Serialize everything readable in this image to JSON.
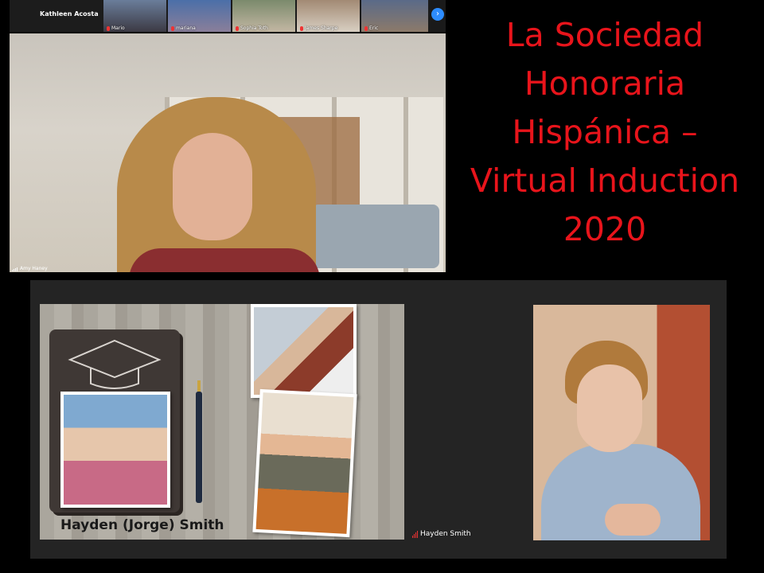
{
  "participants": [
    {
      "name": "Kathleen Acosta"
    },
    {
      "name": "Mario"
    },
    {
      "name": "mariana"
    },
    {
      "name": "Sophia Toth"
    },
    {
      "name": "James Sharpe"
    },
    {
      "name": "Eric"
    }
  ],
  "strip_next_glyph": "›",
  "main_speaker": {
    "name": "Amy Haney"
  },
  "title_lines": [
    "La Sociedad",
    "Honoraria",
    "Hispánica –",
    "Virtual Induction",
    "2020"
  ],
  "title_color": "#e8141b",
  "slide": {
    "caption": "Hayden (Jorge) Smith",
    "shared_by": "Hayden Smith"
  },
  "icons": {
    "mic": "mic-muted-icon",
    "signal": "signal-bars-icon"
  }
}
